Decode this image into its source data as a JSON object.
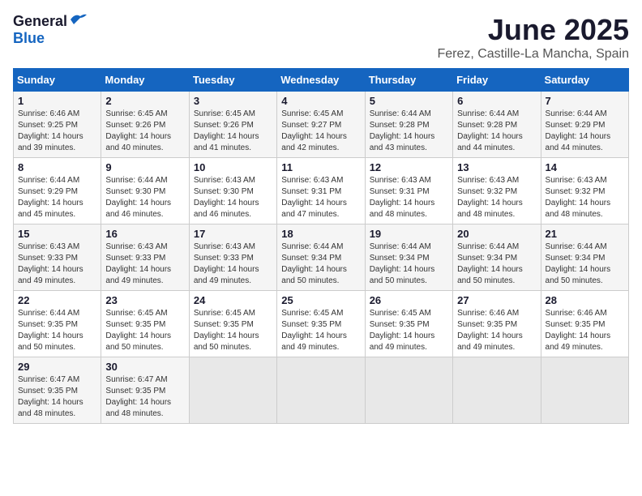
{
  "header": {
    "logo_general": "General",
    "logo_blue": "Blue",
    "month_title": "June 2025",
    "location": "Ferez, Castille-La Mancha, Spain"
  },
  "calendar": {
    "days_of_week": [
      "Sunday",
      "Monday",
      "Tuesday",
      "Wednesday",
      "Thursday",
      "Friday",
      "Saturday"
    ],
    "weeks": [
      [
        {
          "day": "1",
          "sunrise": "Sunrise: 6:46 AM",
          "sunset": "Sunset: 9:25 PM",
          "daylight": "Daylight: 14 hours and 39 minutes."
        },
        {
          "day": "2",
          "sunrise": "Sunrise: 6:45 AM",
          "sunset": "Sunset: 9:26 PM",
          "daylight": "Daylight: 14 hours and 40 minutes."
        },
        {
          "day": "3",
          "sunrise": "Sunrise: 6:45 AM",
          "sunset": "Sunset: 9:26 PM",
          "daylight": "Daylight: 14 hours and 41 minutes."
        },
        {
          "day": "4",
          "sunrise": "Sunrise: 6:45 AM",
          "sunset": "Sunset: 9:27 PM",
          "daylight": "Daylight: 14 hours and 42 minutes."
        },
        {
          "day": "5",
          "sunrise": "Sunrise: 6:44 AM",
          "sunset": "Sunset: 9:28 PM",
          "daylight": "Daylight: 14 hours and 43 minutes."
        },
        {
          "day": "6",
          "sunrise": "Sunrise: 6:44 AM",
          "sunset": "Sunset: 9:28 PM",
          "daylight": "Daylight: 14 hours and 44 minutes."
        },
        {
          "day": "7",
          "sunrise": "Sunrise: 6:44 AM",
          "sunset": "Sunset: 9:29 PM",
          "daylight": "Daylight: 14 hours and 44 minutes."
        }
      ],
      [
        {
          "day": "8",
          "sunrise": "Sunrise: 6:44 AM",
          "sunset": "Sunset: 9:29 PM",
          "daylight": "Daylight: 14 hours and 45 minutes."
        },
        {
          "day": "9",
          "sunrise": "Sunrise: 6:44 AM",
          "sunset": "Sunset: 9:30 PM",
          "daylight": "Daylight: 14 hours and 46 minutes."
        },
        {
          "day": "10",
          "sunrise": "Sunrise: 6:43 AM",
          "sunset": "Sunset: 9:30 PM",
          "daylight": "Daylight: 14 hours and 46 minutes."
        },
        {
          "day": "11",
          "sunrise": "Sunrise: 6:43 AM",
          "sunset": "Sunset: 9:31 PM",
          "daylight": "Daylight: 14 hours and 47 minutes."
        },
        {
          "day": "12",
          "sunrise": "Sunrise: 6:43 AM",
          "sunset": "Sunset: 9:31 PM",
          "daylight": "Daylight: 14 hours and 48 minutes."
        },
        {
          "day": "13",
          "sunrise": "Sunrise: 6:43 AM",
          "sunset": "Sunset: 9:32 PM",
          "daylight": "Daylight: 14 hours and 48 minutes."
        },
        {
          "day": "14",
          "sunrise": "Sunrise: 6:43 AM",
          "sunset": "Sunset: 9:32 PM",
          "daylight": "Daylight: 14 hours and 48 minutes."
        }
      ],
      [
        {
          "day": "15",
          "sunrise": "Sunrise: 6:43 AM",
          "sunset": "Sunset: 9:33 PM",
          "daylight": "Daylight: 14 hours and 49 minutes."
        },
        {
          "day": "16",
          "sunrise": "Sunrise: 6:43 AM",
          "sunset": "Sunset: 9:33 PM",
          "daylight": "Daylight: 14 hours and 49 minutes."
        },
        {
          "day": "17",
          "sunrise": "Sunrise: 6:43 AM",
          "sunset": "Sunset: 9:33 PM",
          "daylight": "Daylight: 14 hours and 49 minutes."
        },
        {
          "day": "18",
          "sunrise": "Sunrise: 6:44 AM",
          "sunset": "Sunset: 9:34 PM",
          "daylight": "Daylight: 14 hours and 50 minutes."
        },
        {
          "day": "19",
          "sunrise": "Sunrise: 6:44 AM",
          "sunset": "Sunset: 9:34 PM",
          "daylight": "Daylight: 14 hours and 50 minutes."
        },
        {
          "day": "20",
          "sunrise": "Sunrise: 6:44 AM",
          "sunset": "Sunset: 9:34 PM",
          "daylight": "Daylight: 14 hours and 50 minutes."
        },
        {
          "day": "21",
          "sunrise": "Sunrise: 6:44 AM",
          "sunset": "Sunset: 9:34 PM",
          "daylight": "Daylight: 14 hours and 50 minutes."
        }
      ],
      [
        {
          "day": "22",
          "sunrise": "Sunrise: 6:44 AM",
          "sunset": "Sunset: 9:35 PM",
          "daylight": "Daylight: 14 hours and 50 minutes."
        },
        {
          "day": "23",
          "sunrise": "Sunrise: 6:45 AM",
          "sunset": "Sunset: 9:35 PM",
          "daylight": "Daylight: 14 hours and 50 minutes."
        },
        {
          "day": "24",
          "sunrise": "Sunrise: 6:45 AM",
          "sunset": "Sunset: 9:35 PM",
          "daylight": "Daylight: 14 hours and 50 minutes."
        },
        {
          "day": "25",
          "sunrise": "Sunrise: 6:45 AM",
          "sunset": "Sunset: 9:35 PM",
          "daylight": "Daylight: 14 hours and 49 minutes."
        },
        {
          "day": "26",
          "sunrise": "Sunrise: 6:45 AM",
          "sunset": "Sunset: 9:35 PM",
          "daylight": "Daylight: 14 hours and 49 minutes."
        },
        {
          "day": "27",
          "sunrise": "Sunrise: 6:46 AM",
          "sunset": "Sunset: 9:35 PM",
          "daylight": "Daylight: 14 hours and 49 minutes."
        },
        {
          "day": "28",
          "sunrise": "Sunrise: 6:46 AM",
          "sunset": "Sunset: 9:35 PM",
          "daylight": "Daylight: 14 hours and 49 minutes."
        }
      ],
      [
        {
          "day": "29",
          "sunrise": "Sunrise: 6:47 AM",
          "sunset": "Sunset: 9:35 PM",
          "daylight": "Daylight: 14 hours and 48 minutes."
        },
        {
          "day": "30",
          "sunrise": "Sunrise: 6:47 AM",
          "sunset": "Sunset: 9:35 PM",
          "daylight": "Daylight: 14 hours and 48 minutes."
        },
        null,
        null,
        null,
        null,
        null
      ]
    ]
  }
}
